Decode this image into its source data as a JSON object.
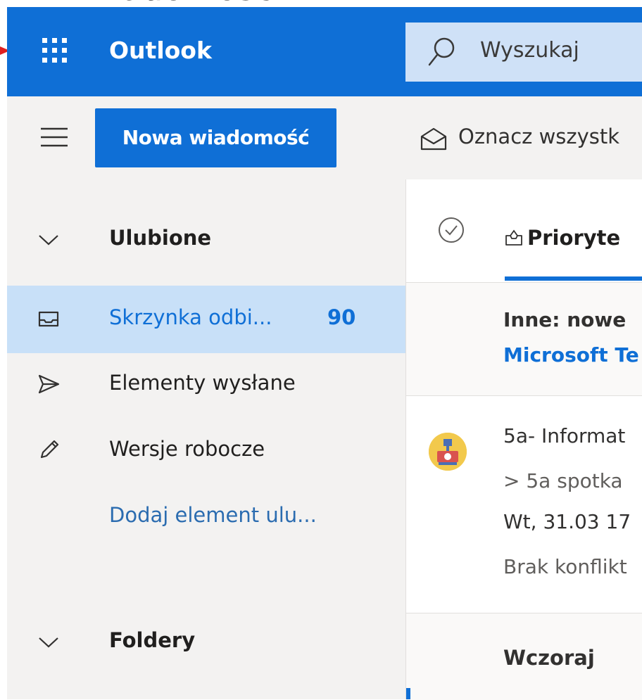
{
  "app": {
    "brand": "Outlook"
  },
  "colors": {
    "accent": "#0f6fd6",
    "selected_bg": "#c8e0f8",
    "pane_bg": "#f3f2f1",
    "annotation": "#e02020"
  },
  "annotation": {
    "top_caption": "Wiadomości"
  },
  "search": {
    "placeholder": "Wyszukaj",
    "icon": "search-icon"
  },
  "toolbar": {
    "new_message_label": "Nowa wiadomość",
    "mark_all_label": "Oznacz wszystk",
    "icons": [
      "hamburger-icon",
      "envelope-open-icon"
    ]
  },
  "sidebar": {
    "favorites_header": "Ulubione",
    "items": [
      {
        "label": "Skrzynka odbi...",
        "count": "90",
        "icon": "inbox-icon",
        "selected": true
      },
      {
        "label": "Elementy wysłane",
        "icon": "send-icon"
      },
      {
        "label": "Wersje robocze",
        "icon": "pencil-icon"
      }
    ],
    "add_favorite_label": "Dodaj element ulu...",
    "folders_header": "Foldery"
  },
  "message_list": {
    "tab_focused_label": "Prioryte",
    "other_banner": {
      "line1": "Inne: nowe",
      "line2": "Microsoft Te"
    },
    "messages": [
      {
        "subject": "5a- Informat",
        "preview": "> 5a spotka",
        "time": "Wt, 31.03 17",
        "note": "Brak konflikt",
        "avatar_icon": "group-avatar-icon"
      }
    ],
    "day_header": "Wczoraj"
  }
}
